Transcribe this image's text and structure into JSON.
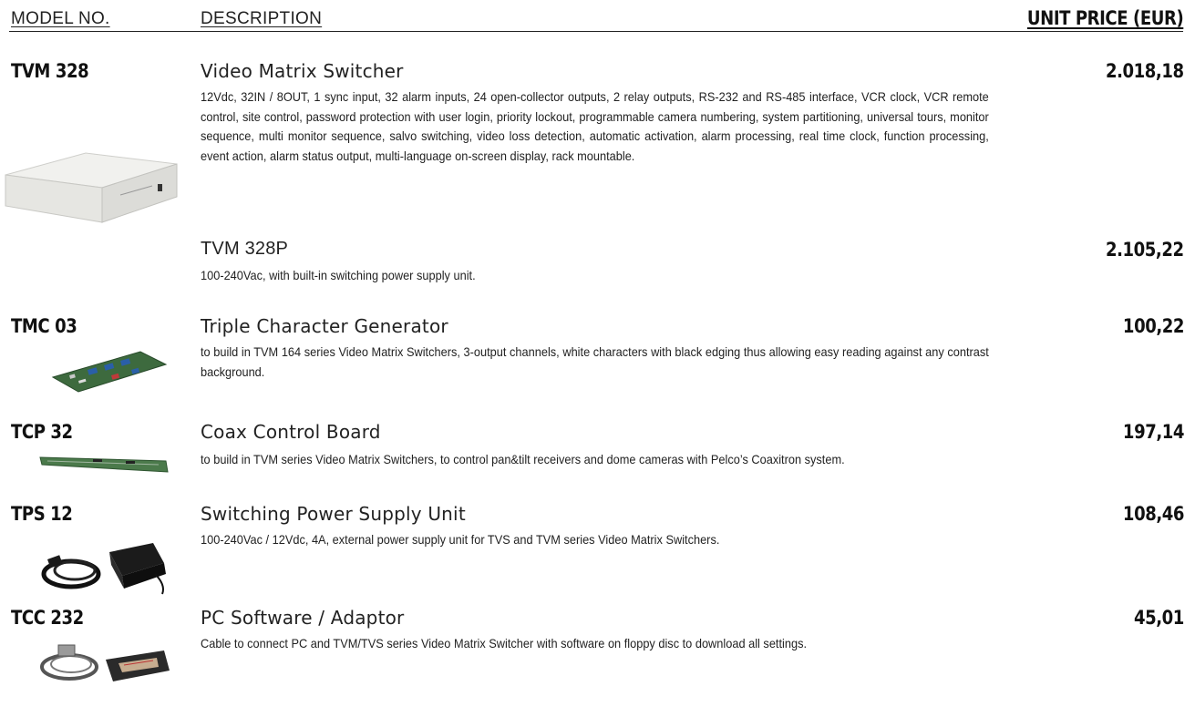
{
  "header": {
    "model_label": "MODEL NO.",
    "description_label": "DESCRIPTION",
    "price_label": "UNIT PRICE (EUR)"
  },
  "items": [
    {
      "model": "TVM 328",
      "title": "Video Matrix Switcher",
      "description": "12Vdc, 32IN / 8OUT, 1 sync input, 32 alarm inputs, 24 open-collector outputs, 2 relay outputs, RS-232 and RS-485 interface, VCR clock, VCR remote control, site control, password protection with user login, priority lockout, programmable camera numbering, system partitioning, universal tours, monitor sequence, multi monitor sequence, salvo switching, video loss detection, automatic activation, alarm processing, real time clock, function processing, event action, alarm status output, multi-language on-screen display, rack mountable.",
      "price": "2.018,18",
      "image_icon": "rack-unit-icon"
    },
    {
      "model": "",
      "title": "TVM 328P",
      "description": "100-240Vac, with built-in switching power supply unit.",
      "price": "2.105,22"
    },
    {
      "model": "TMC 03",
      "title": "Triple Character Generator",
      "description": "to build in TVM 164 series Video Matrix Switchers, 3-output channels, white characters with black edging thus allowing easy reading against any contrast background.",
      "price": "100,22",
      "image_icon": "circuit-board-icon"
    },
    {
      "model": "TCP 32",
      "title": "Coax Control Board",
      "description": "to build in TVM series Video Matrix Switchers, to control pan&tilt receivers and dome cameras with Pelco’s Coaxitron system.",
      "price": "197,14",
      "image_icon": "long-board-icon"
    },
    {
      "model": "TPS 12",
      "title": "Switching Power Supply Unit",
      "description": "100-240Vac / 12Vdc, 4A, external power supply unit for TVS and TVM series Video Matrix Switchers.",
      "price": "108,46",
      "image_icon": "power-adapter-icon"
    },
    {
      "model": "TCC 232",
      "title": "PC Software / Adaptor",
      "description": "Cable to connect PC and TVM/TVS series Video Matrix Switcher with software on floppy disc to download all settings.",
      "price": "45,01",
      "image_icon": "cable-floppy-icon"
    }
  ]
}
